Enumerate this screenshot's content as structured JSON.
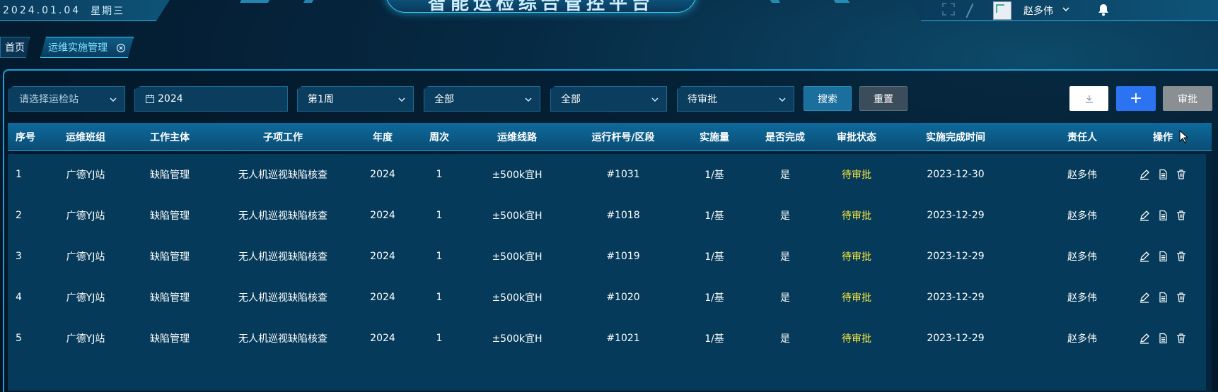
{
  "header": {
    "date": "2024.01.04",
    "weekday": "星期三",
    "title": "智能运检综合管控平台",
    "username": "赵多伟"
  },
  "tabs": [
    {
      "label": "首页"
    },
    {
      "label": "运维实施管理"
    }
  ],
  "filters": {
    "station_placeholder": "请选择运检站",
    "year": "2024",
    "week": "第1周",
    "filter_a": "全部",
    "filter_b": "全部",
    "status": "待审批"
  },
  "buttons": {
    "search": "搜索",
    "reset": "重置",
    "add": "+",
    "approve": "审批"
  },
  "table": {
    "headers": [
      "序号",
      "运维班组",
      "工作主体",
      "子项工作",
      "年度",
      "周次",
      "运维线路",
      "运行杆号/区段",
      "实施量",
      "是否完成",
      "审批状态",
      "实施完成时间",
      "责任人",
      "操作"
    ],
    "rows": [
      [
        "1",
        "广德YJ站",
        "缺陷管理",
        "无人机巡视缺陷核查",
        "2024",
        "1",
        "±500k宜H",
        "#1031",
        "1/基",
        "是",
        "待审批",
        "2023-12-30",
        "赵多伟"
      ],
      [
        "2",
        "广德YJ站",
        "缺陷管理",
        "无人机巡视缺陷核查",
        "2024",
        "1",
        "±500k宜H",
        "#1018",
        "1/基",
        "是",
        "待审批",
        "2023-12-29",
        "赵多伟"
      ],
      [
        "3",
        "广德YJ站",
        "缺陷管理",
        "无人机巡视缺陷核查",
        "2024",
        "1",
        "±500k宜H",
        "#1019",
        "1/基",
        "是",
        "待审批",
        "2023-12-29",
        "赵多伟"
      ],
      [
        "4",
        "广德YJ站",
        "缺陷管理",
        "无人机巡视缺陷核查",
        "2024",
        "1",
        "±500k宜H",
        "#1020",
        "1/基",
        "是",
        "待审批",
        "2023-12-29",
        "赵多伟"
      ],
      [
        "5",
        "广德YJ站",
        "缺陷管理",
        "无人机巡视缺陷核查",
        "2024",
        "1",
        "±500k宜H",
        "#1021",
        "1/基",
        "是",
        "待审批",
        "2023-12-29",
        "赵多伟"
      ]
    ]
  },
  "icons": {
    "fullscreen": "fullscreen-icon",
    "user_menu": "chevron-down-icon",
    "notifications": "bell-icon",
    "tab_close": "close-circle-icon",
    "calendar": "calendar-icon",
    "download": "download-icon",
    "edit": "edit-icon",
    "detail": "document-icon",
    "delete": "trash-icon"
  },
  "colors": {
    "pending_status": "#ffec3d",
    "accent": "#1d9fd6",
    "add_button": "#2c73f2"
  }
}
